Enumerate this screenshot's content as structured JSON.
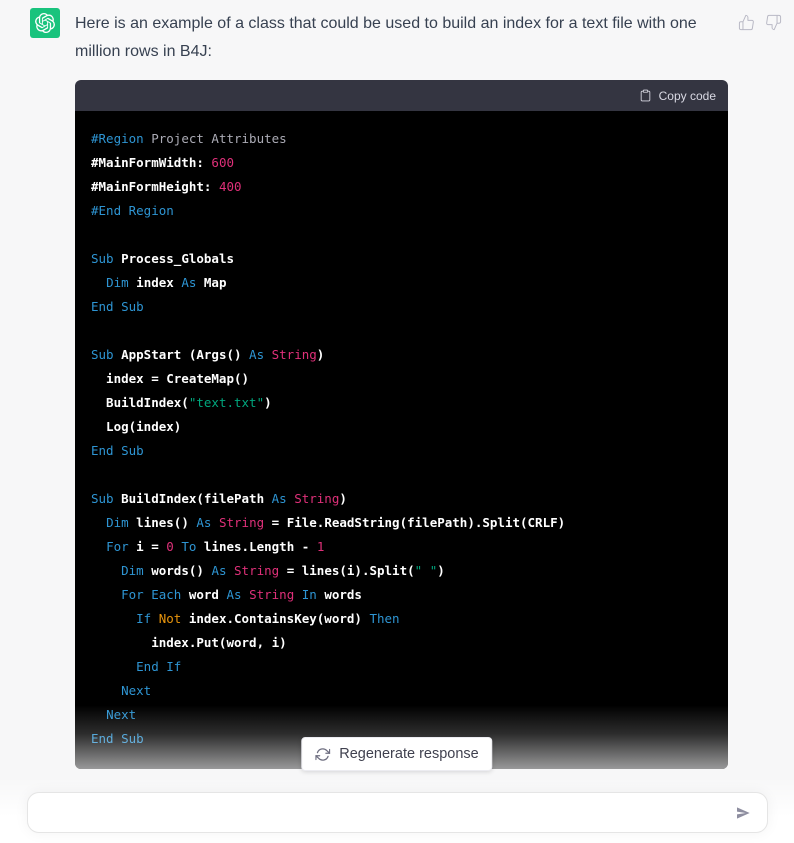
{
  "message": {
    "text": "Here is an example of a class that could be used to build an index for a text file with one million rows in B4J:"
  },
  "feedback": {
    "thumbs_up_icon": "thumbs-up",
    "thumbs_down_icon": "thumbs-down"
  },
  "code_block": {
    "copy_label": "Copy code",
    "copy_icon": "clipboard",
    "colors": {
      "header_bg": "#343541",
      "body_bg": "#000000",
      "keyword": "#2e95d3",
      "type": "#df3079",
      "number": "#df3079",
      "string": "#00a67d",
      "builtin": "#e9950c",
      "plain": "#ffffff",
      "meta_text": "#ababb5"
    },
    "lines": [
      [
        [
          "kw",
          "#Region"
        ],
        [
          "gray",
          " Project Attributes"
        ]
      ],
      [
        [
          "pln",
          "#MainFormWidth: "
        ],
        [
          "num",
          "600"
        ]
      ],
      [
        [
          "pln",
          "#MainFormHeight: "
        ],
        [
          "num",
          "400"
        ]
      ],
      [
        [
          "kw",
          "#End Region"
        ]
      ],
      [],
      [
        [
          "kw",
          "Sub "
        ],
        [
          "pln",
          "Process_Globals"
        ]
      ],
      [
        [
          "pln",
          "  "
        ],
        [
          "kw",
          "Dim "
        ],
        [
          "pln",
          "index "
        ],
        [
          "kw",
          "As "
        ],
        [
          "pln",
          "Map"
        ]
      ],
      [
        [
          "kw",
          "End Sub"
        ]
      ],
      [],
      [
        [
          "kw",
          "Sub "
        ],
        [
          "pln",
          "AppStart (Args() "
        ],
        [
          "kw",
          "As "
        ],
        [
          "typ",
          "String"
        ],
        [
          "pln",
          ")"
        ]
      ],
      [
        [
          "pln",
          "  index = CreateMap()"
        ]
      ],
      [
        [
          "pln",
          "  BuildIndex("
        ],
        [
          "str",
          "\"text.txt\""
        ],
        [
          "pln",
          ")"
        ]
      ],
      [
        [
          "pln",
          "  Log(index)"
        ]
      ],
      [
        [
          "kw",
          "End Sub"
        ]
      ],
      [],
      [
        [
          "kw",
          "Sub "
        ],
        [
          "pln",
          "BuildIndex(filePath "
        ],
        [
          "kw",
          "As "
        ],
        [
          "typ",
          "String"
        ],
        [
          "pln",
          ")"
        ]
      ],
      [
        [
          "pln",
          "  "
        ],
        [
          "kw",
          "Dim "
        ],
        [
          "pln",
          "lines() "
        ],
        [
          "kw",
          "As "
        ],
        [
          "typ",
          "String"
        ],
        [
          "pln",
          " = File.ReadString(filePath).Split(CRLF)"
        ]
      ],
      [
        [
          "pln",
          "  "
        ],
        [
          "kw",
          "For "
        ],
        [
          "pln",
          "i = "
        ],
        [
          "num",
          "0"
        ],
        [
          "pln",
          " "
        ],
        [
          "kw",
          "To "
        ],
        [
          "pln",
          "lines.Length - "
        ],
        [
          "num",
          "1"
        ]
      ],
      [
        [
          "pln",
          "    "
        ],
        [
          "kw",
          "Dim "
        ],
        [
          "pln",
          "words() "
        ],
        [
          "kw",
          "As "
        ],
        [
          "typ",
          "String"
        ],
        [
          "pln",
          " = lines(i).Split("
        ],
        [
          "str",
          "\" \""
        ],
        [
          "pln",
          ")"
        ]
      ],
      [
        [
          "pln",
          "    "
        ],
        [
          "kw",
          "For Each "
        ],
        [
          "pln",
          "word "
        ],
        [
          "kw",
          "As "
        ],
        [
          "typ",
          "String"
        ],
        [
          "kw",
          " In "
        ],
        [
          "pln",
          "words"
        ]
      ],
      [
        [
          "pln",
          "      "
        ],
        [
          "kw",
          "If "
        ],
        [
          "bi",
          "Not "
        ],
        [
          "pln",
          "index.ContainsKey(word) "
        ],
        [
          "kw",
          "Then"
        ]
      ],
      [
        [
          "pln",
          "        index.Put(word, i)"
        ]
      ],
      [
        [
          "pln",
          "      "
        ],
        [
          "kw",
          "End If"
        ]
      ],
      [
        [
          "pln",
          "    "
        ],
        [
          "kw",
          "Next"
        ]
      ],
      [
        [
          "pln",
          "  "
        ],
        [
          "kw",
          "Next"
        ]
      ],
      [
        [
          "kw",
          "End Sub"
        ]
      ]
    ]
  },
  "regenerate": {
    "label": "Regenerate response",
    "icon": "refresh"
  },
  "composer": {
    "value": "",
    "placeholder": "",
    "send_icon": "send"
  }
}
